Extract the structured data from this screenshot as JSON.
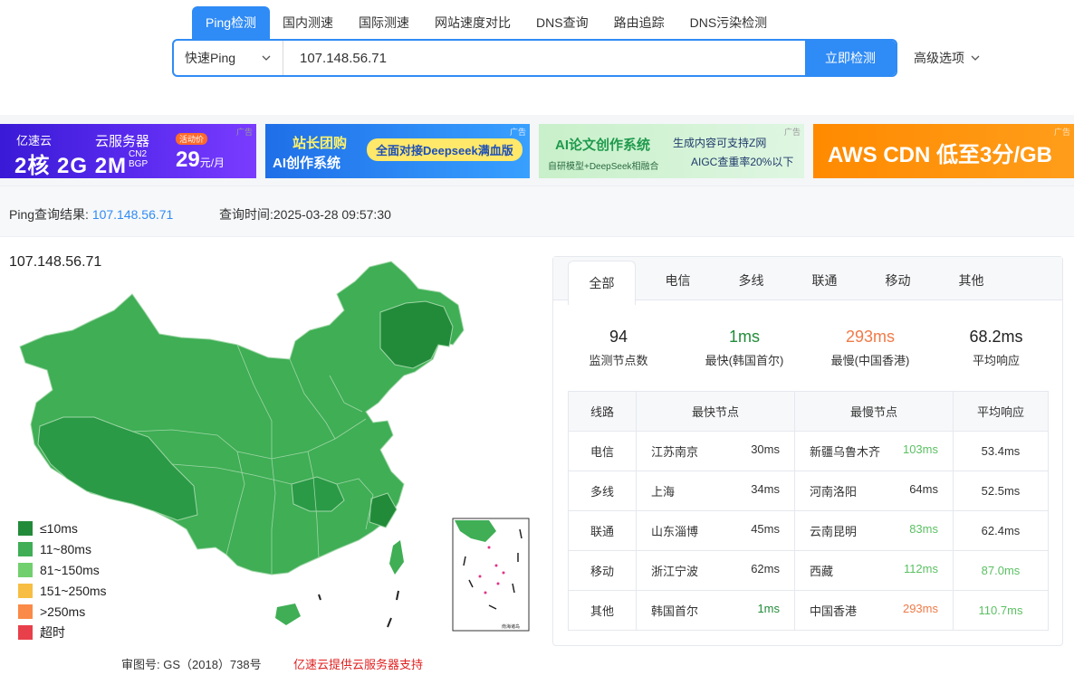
{
  "tabs": [
    {
      "label": "Ping检测",
      "active": true
    },
    {
      "label": "国内测速"
    },
    {
      "label": "国际测速"
    },
    {
      "label": "网站速度对比"
    },
    {
      "label": "DNS查询"
    },
    {
      "label": "路由追踪"
    },
    {
      "label": "DNS污染检测"
    }
  ],
  "search": {
    "mode": "快速Ping",
    "value": "107.148.56.71",
    "button": "立即检测",
    "advanced": "高级选项"
  },
  "ads": {
    "tag": "广告",
    "ad1": {
      "brand": "亿速云",
      "title": "云服务器",
      "spec": "2核 2G 2M",
      "cn2": "CN2",
      "bgp": "BGP",
      "badge": "活动价",
      "price": "29",
      "unit": "元/月"
    },
    "ad2": {
      "t1": "站长团购",
      "t2": "AI创作系统",
      "pill": "全面对接Deepseek满血版"
    },
    "ad3": {
      "t1": "AI论文创作系统",
      "t2": "自研模型+DeepSeek相融合",
      "t3": "生成内容可支持Z网",
      "t4": "AIGC查重率20%以下"
    },
    "ad4": {
      "t1": "AWS CDN 低至3分/GB"
    }
  },
  "summary": {
    "result_label": "Ping查询结果:",
    "result_ip": "107.148.56.71",
    "time_label": "查询时间:",
    "time_value": "2025-03-28 09:57:30"
  },
  "map": {
    "host": "107.148.56.71",
    "legend": [
      {
        "label": "≤10ms",
        "color": "#228b3a"
      },
      {
        "label": "11~80ms",
        "color": "#3fae55"
      },
      {
        "label": "81~150ms",
        "color": "#72cf6e"
      },
      {
        "label": "151~250ms",
        "color": "#f7be43"
      },
      {
        "label": ">250ms",
        "color": "#fa8a48"
      },
      {
        "label": "超时",
        "color": "#e8404a"
      }
    ],
    "inset_label": "南海诸岛"
  },
  "footer": {
    "license": "审图号: GS（2018）738号",
    "sponsor": "亿速云提供云服务器支持"
  },
  "panel": {
    "tabs": [
      {
        "label": "全部",
        "active": true
      },
      {
        "label": "电信"
      },
      {
        "label": "多线"
      },
      {
        "label": "联通"
      },
      {
        "label": "移动"
      },
      {
        "label": "其他"
      }
    ],
    "stats": [
      {
        "value": "94",
        "label": "监测节点数",
        "color": "#222222"
      },
      {
        "value": "1ms",
        "label": "最快(韩国首尔)",
        "color": "#228b3a"
      },
      {
        "value": "293ms",
        "label": "最慢(中国香港)",
        "color": "#f07a48"
      },
      {
        "value": "68.2ms",
        "label": "平均响应",
        "color": "#222222"
      }
    ],
    "headers": [
      "线路",
      "最快节点",
      "最慢节点",
      "平均响应"
    ],
    "rows": [
      {
        "line": "电信",
        "fast_node": "江苏南京",
        "fast_ms": "30ms",
        "fast_color": "#333333",
        "slow_node": "新疆乌鲁木齐",
        "slow_ms": "103ms",
        "slow_color": "#5cc064",
        "avg": "53.4ms",
        "avg_color": "#333333"
      },
      {
        "line": "多线",
        "fast_node": "上海",
        "fast_ms": "34ms",
        "fast_color": "#333333",
        "slow_node": "河南洛阳",
        "slow_ms": "64ms",
        "slow_color": "#333333",
        "avg": "52.5ms",
        "avg_color": "#333333"
      },
      {
        "line": "联通",
        "fast_node": "山东淄博",
        "fast_ms": "45ms",
        "fast_color": "#333333",
        "slow_node": "云南昆明",
        "slow_ms": "83ms",
        "slow_color": "#5cc064",
        "avg": "62.4ms",
        "avg_color": "#333333"
      },
      {
        "line": "移动",
        "fast_node": "浙江宁波",
        "fast_ms": "62ms",
        "fast_color": "#333333",
        "slow_node": "西藏",
        "slow_ms": "112ms",
        "slow_color": "#5cc064",
        "avg": "87.0ms",
        "avg_color": "#5cc064"
      },
      {
        "line": "其他",
        "fast_node": "韩国首尔",
        "fast_ms": "1ms",
        "fast_color": "#228b3a",
        "slow_node": "中国香港",
        "slow_ms": "293ms",
        "slow_color": "#f07a48",
        "avg": "110.7ms",
        "avg_color": "#5cc064"
      }
    ]
  }
}
